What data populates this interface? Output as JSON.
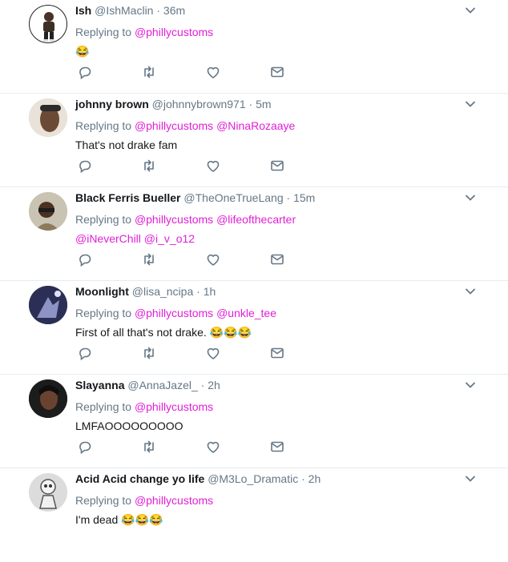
{
  "tweets": [
    {
      "name": "Ish",
      "handle": "@IshMaclin",
      "time": "36m",
      "replying_label": "Replying to",
      "mentions": [
        "@phillycustoms"
      ],
      "text": "😂"
    },
    {
      "name": "johnny brown",
      "handle": "@johnnybrown971",
      "time": "5m",
      "replying_label": "Replying to",
      "mentions": [
        "@phillycustoms",
        "@NinaRozaaye"
      ],
      "text": "That's not drake fam"
    },
    {
      "name": "Black Ferris Bueller",
      "handle": "@TheOneTrueLang",
      "time": "15m",
      "replying_label": "Replying to",
      "mentions": [
        "@phillycustoms",
        "@lifeofthecarter",
        "@iNeverChill",
        "@i_v_o12"
      ],
      "text": ""
    },
    {
      "name": "Moonlight",
      "handle": "@lisa_ncipa",
      "time": "1h",
      "replying_label": "Replying to",
      "mentions": [
        "@phillycustoms",
        "@unkle_tee"
      ],
      "text": "First of all that's not drake. 😂😂😂"
    },
    {
      "name": "Slayanna",
      "handle": "@AnnaJazel_",
      "time": "2h",
      "replying_label": "Replying to",
      "mentions": [
        "@phillycustoms"
      ],
      "text": "LMFAOOOOOOOOO"
    },
    {
      "name": "Acid Acid change yo life",
      "handle": "@M3Lo_Dramatic",
      "time": "2h",
      "replying_label": "Replying to",
      "mentions": [
        "@phillycustoms"
      ],
      "text": "I'm dead 😂😂😂"
    }
  ],
  "separator": "·",
  "icons": {
    "reply": "reply-icon",
    "retweet": "retweet-icon",
    "like": "heart-icon",
    "dm": "envelope-icon",
    "menu": "chevron-down-icon"
  },
  "colors": {
    "mention": "#e01fd6",
    "secondary_text": "#657786",
    "icon": "#657786",
    "divider": "#e6ecf0"
  }
}
